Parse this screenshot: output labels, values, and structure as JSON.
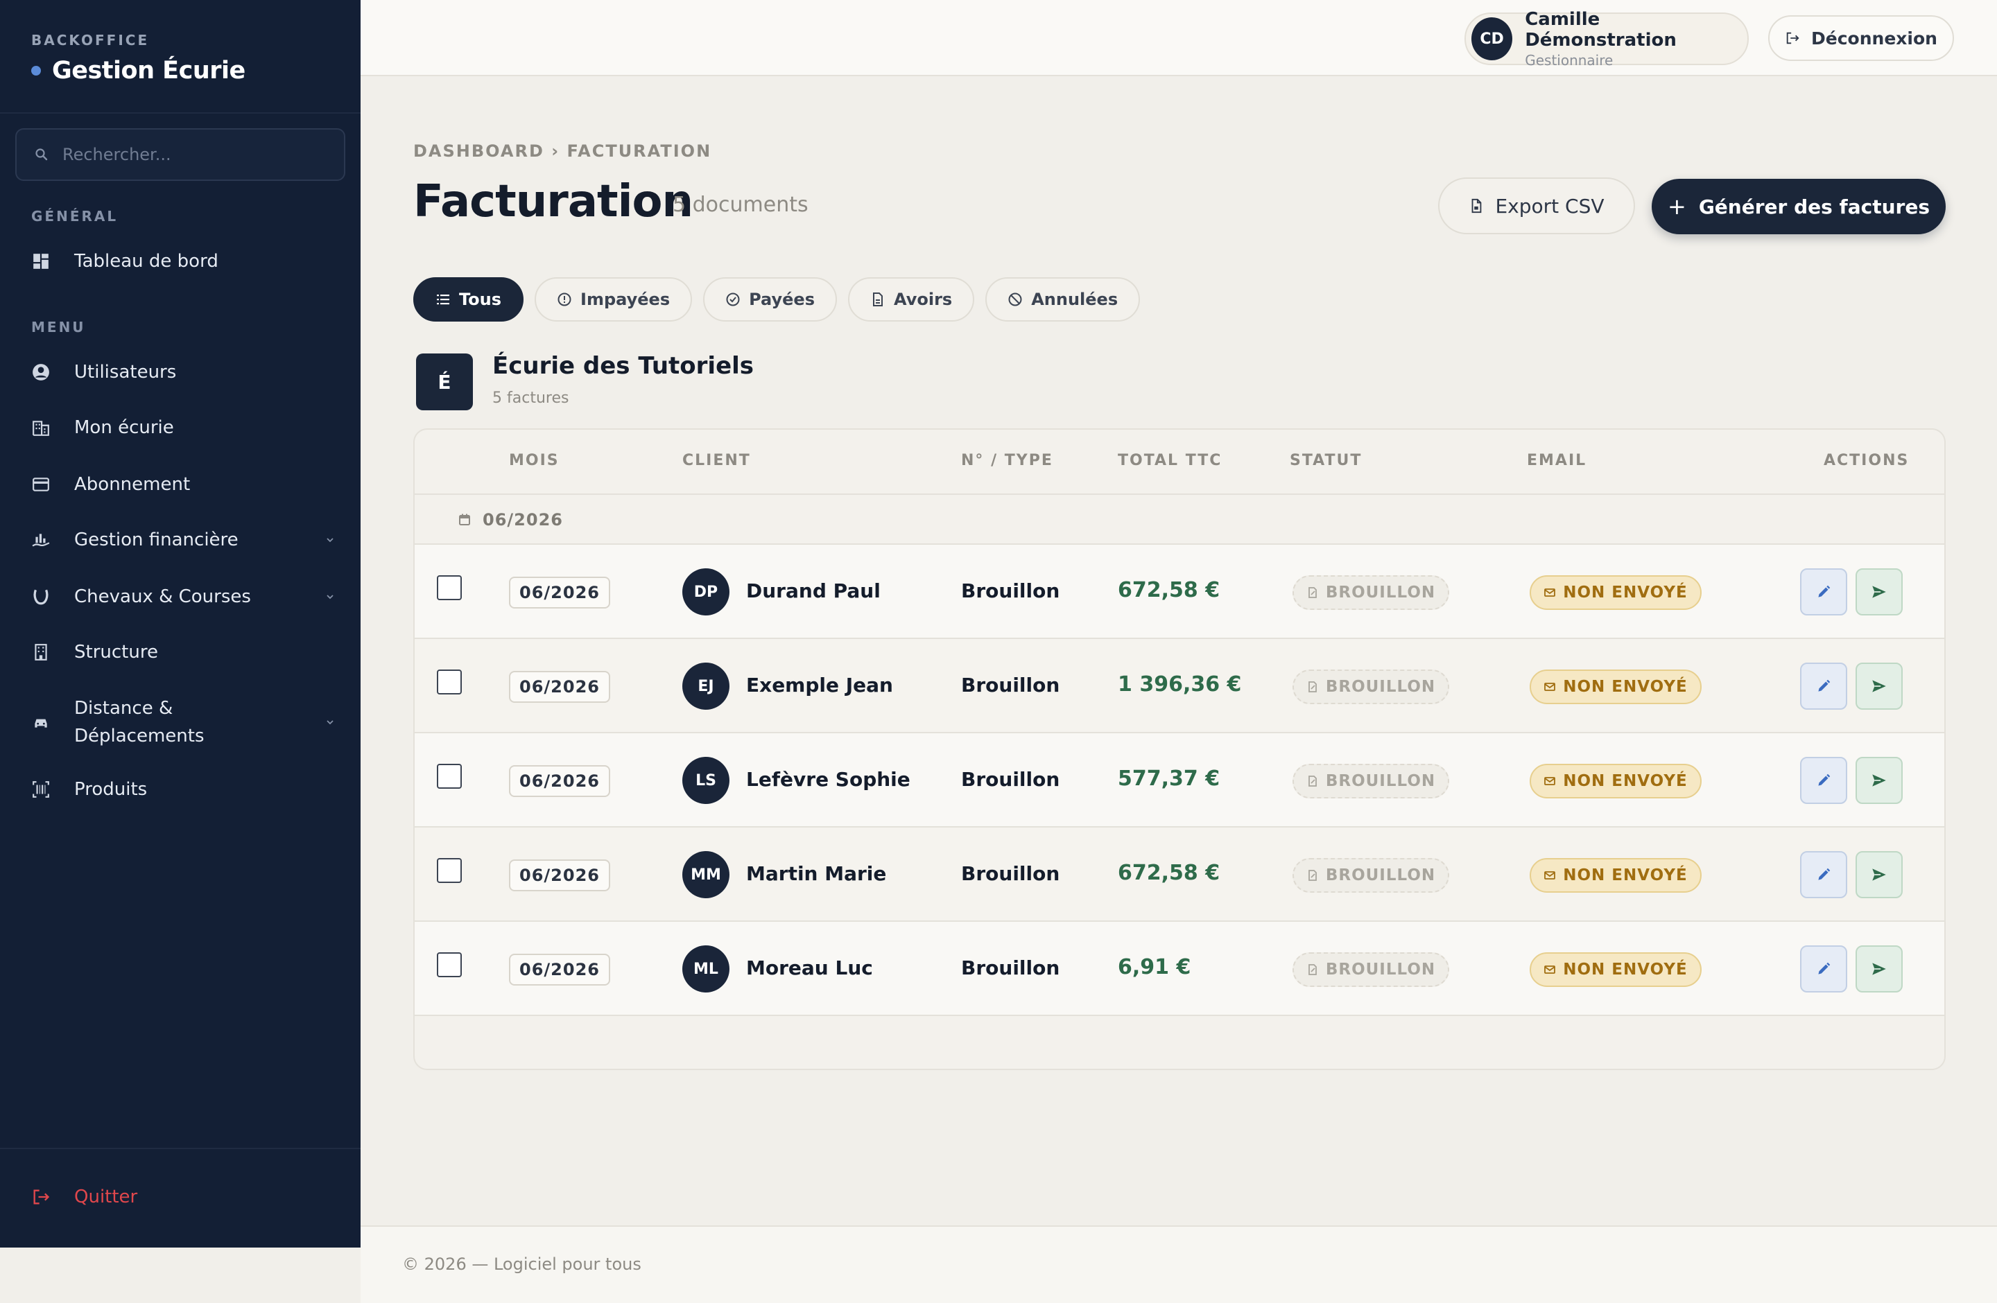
{
  "sidebar": {
    "brand_kicker": "BACKOFFICE",
    "brand_title": "Gestion Écurie",
    "search_placeholder": "Rechercher...",
    "section_general": "GÉNÉRAL",
    "section_menu": "MENU",
    "items": [
      {
        "label": "Tableau de bord",
        "icon": "dashboard-icon"
      },
      {
        "label": "Utilisateurs",
        "icon": "user-circle-icon"
      },
      {
        "label": "Mon écurie",
        "icon": "building-icon"
      },
      {
        "label": "Abonnement",
        "icon": "credit-card-icon"
      },
      {
        "label": "Gestion financière",
        "icon": "chart-hand-icon",
        "expandable": true
      },
      {
        "label": "Chevaux & Courses",
        "icon": "horseshoe-icon",
        "expandable": true
      },
      {
        "label": "Structure",
        "icon": "tower-icon"
      },
      {
        "label_line1": "Distance &",
        "label_line2": "Déplacements",
        "icon": "car-icon",
        "expandable": true
      },
      {
        "label": "Produits",
        "icon": "barcode-icon"
      }
    ],
    "quit_label": "Quitter"
  },
  "topbar": {
    "user_initials": "CD",
    "user_name": "Camille Démonstration",
    "user_role": "Gestionnaire",
    "logout_label": "Déconnexion"
  },
  "page": {
    "breadcrumb": "DASHBOARD › FACTURATION",
    "title": "Facturation",
    "doc_count": "5 documents",
    "export_label": "Export CSV",
    "generate_label": "Générer des factures"
  },
  "filters": [
    {
      "label": "Tous",
      "active": true,
      "icon": "list-icon"
    },
    {
      "label": "Impayées",
      "active": false,
      "icon": "alert-circle-icon"
    },
    {
      "label": "Payées",
      "active": false,
      "icon": "check-circle-icon"
    },
    {
      "label": "Avoirs",
      "active": false,
      "icon": "document-icon"
    },
    {
      "label": "Annulées",
      "active": false,
      "icon": "ban-icon"
    }
  ],
  "group": {
    "badge": "É",
    "title": "Écurie des Tutoriels",
    "subtitle": "5 factures"
  },
  "table": {
    "headers": {
      "mois": "MOIS",
      "client": "CLIENT",
      "type": "N° / TYPE",
      "total": "TOTAL TTC",
      "statut": "STATUT",
      "email": "EMAIL",
      "actions": "ACTIONS"
    },
    "month_group": "06/2026",
    "rows": [
      {
        "month": "06/2026",
        "initials": "DP",
        "client": "Durand Paul",
        "type": "Brouillon",
        "total": "672,58 €",
        "status": "BROUILLON",
        "email": "NON ENVOYÉ"
      },
      {
        "month": "06/2026",
        "initials": "EJ",
        "client": "Exemple Jean",
        "type": "Brouillon",
        "total": "1 396,36 €",
        "status": "BROUILLON",
        "email": "NON ENVOYÉ"
      },
      {
        "month": "06/2026",
        "initials": "LS",
        "client": "Lefèvre Sophie",
        "type": "Brouillon",
        "total": "577,37 €",
        "status": "BROUILLON",
        "email": "NON ENVOYÉ"
      },
      {
        "month": "06/2026",
        "initials": "MM",
        "client": "Martin Marie",
        "type": "Brouillon",
        "total": "672,58 €",
        "status": "BROUILLON",
        "email": "NON ENVOYÉ"
      },
      {
        "month": "06/2026",
        "initials": "ML",
        "client": "Moreau Luc",
        "type": "Brouillon",
        "total": "6,91 €",
        "status": "BROUILLON",
        "email": "NON ENVOYÉ"
      }
    ]
  },
  "footer": {
    "text": "© 2026 — Logiciel pour tous"
  },
  "colors": {
    "sidebar_bg": "#131f35",
    "accent_dark": "#1b2639",
    "total_green": "#2e6b4a",
    "warning_bg": "#f6e8c4",
    "danger": "#e0474c"
  }
}
